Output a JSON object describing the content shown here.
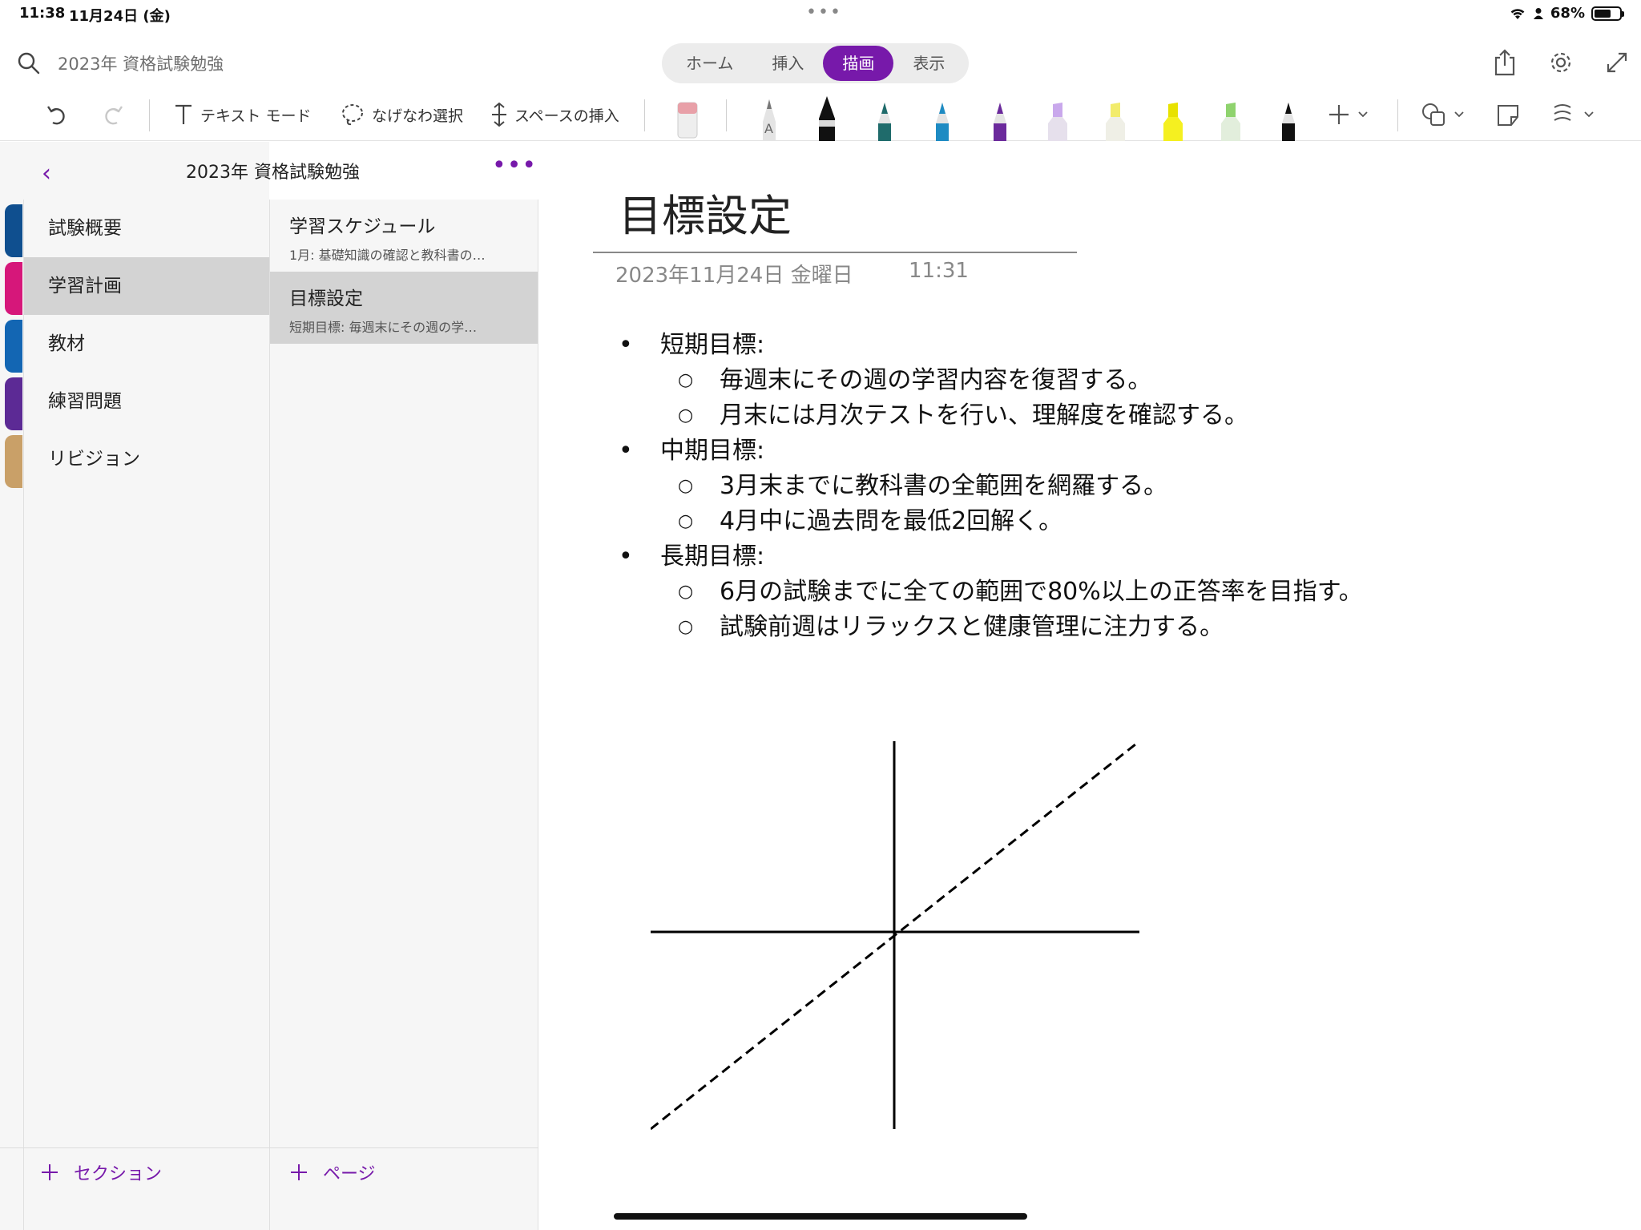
{
  "status_bar": {
    "time": "11:38",
    "date": "11月24日 (金)",
    "battery": "68%"
  },
  "top_bar": {
    "search_text": "2023年 資格試験勉強",
    "tabs": [
      {
        "label": "ホーム",
        "active": false
      },
      {
        "label": "挿入",
        "active": false
      },
      {
        "label": "描画",
        "active": true
      },
      {
        "label": "表示",
        "active": false
      }
    ],
    "icons": [
      "share-icon",
      "settings-icon",
      "expand-icon"
    ]
  },
  "toolbar": {
    "text_mode": "テキスト モード",
    "lasso": "なげなわ選択",
    "insert_space": "スペースの挿入",
    "pens": [
      {
        "name": "eraser",
        "color": "#e8a0a8"
      },
      {
        "name": "pencil",
        "color": "#8a8a8a"
      },
      {
        "name": "pen-black",
        "color": "#111111"
      },
      {
        "name": "pen-teal",
        "color": "#1f6b6b"
      },
      {
        "name": "pen-blue",
        "color": "#1e8bc3"
      },
      {
        "name": "pen-purple",
        "color": "#6b2a9c"
      },
      {
        "name": "highlighter-lavender",
        "color": "#c9a8ec"
      },
      {
        "name": "highlighter-yellow",
        "color": "#f2ec6c"
      },
      {
        "name": "highlighter-yellow2",
        "color": "#f5f020"
      },
      {
        "name": "highlighter-green",
        "color": "#8fd36e"
      },
      {
        "name": "pen-black2",
        "color": "#111111"
      }
    ]
  },
  "notebook": {
    "title": "2023年 資格試験勉強",
    "sections": [
      {
        "label": "試験概要",
        "color": "#0f4f8f",
        "active": false
      },
      {
        "label": "学習計画",
        "color": "#d6177a",
        "active": true
      },
      {
        "label": "教材",
        "color": "#1366b3",
        "active": false
      },
      {
        "label": "練習問題",
        "color": "#5c2a95",
        "active": false
      },
      {
        "label": "リビジョン",
        "color": "#c9a068",
        "active": false
      }
    ],
    "add_section": "セクション",
    "pages": [
      {
        "title": "学習スケジュール",
        "snippet": "1月: 基礎知識の確認と教科書の…",
        "active": false
      },
      {
        "title": "目標設定",
        "snippet": "短期目標: 毎週末にその週の学…",
        "active": true
      }
    ],
    "add_page": "ページ"
  },
  "note": {
    "title": "目標設定",
    "date": "2023年11月24日 金曜日",
    "time": "11:31",
    "outline": [
      {
        "heading": "短期目標:",
        "items": [
          "毎週末にその週の学習内容を復習する。",
          "月末には月次テストを行い、理解度を確認する。"
        ]
      },
      {
        "heading": "中期目標:",
        "items": [
          "3月末までに教科書の全範囲を網羅する。",
          "4月中に過去問を最低2回解く。"
        ]
      },
      {
        "heading": "長期目標:",
        "items": [
          "6月の試験までに全ての範囲で80%以上の正答率を目指す。",
          "試験前週はリラックスと健康管理に注力する。"
        ]
      }
    ]
  },
  "colors": {
    "accent": "#7719aa",
    "selected_bg": "#d3d3d3",
    "sidebar_bg": "#f6f6f6"
  }
}
